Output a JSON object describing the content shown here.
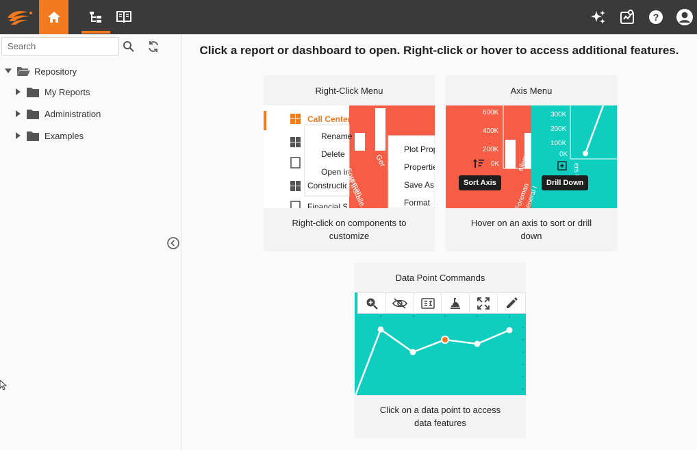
{
  "toolbar": {
    "logo_icon": "flame-logo-icon",
    "home_icon": "home-icon",
    "tree_icon": "tree-view-icon",
    "book_icon": "book-icon",
    "sparkle_icon": "sparkle-icon",
    "dashboard_icon": "dashboard-icon",
    "help_icon": "help-icon",
    "user_icon": "account-icon",
    "accent_color": "#f47a20"
  },
  "sidebar": {
    "search_placeholder": "Search",
    "tree": [
      {
        "label": "Repository",
        "expanded": true
      },
      {
        "label": "My Reports"
      },
      {
        "label": "Administration"
      },
      {
        "label": "Examples"
      }
    ]
  },
  "main": {
    "title": "Click a report or dashboard to open. Right-click or hover to access additional features.",
    "cards": [
      {
        "title": "Right-Click Menu",
        "description": "Right-click on components to customize",
        "items": [
          "Call Center",
          "Constructio",
          "Financial S"
        ],
        "context_menu": [
          "Rename",
          "Delete",
          "Open in"
        ],
        "sub_menu": [
          "Plot Prop",
          "Propertie",
          "Save As",
          "Format"
        ],
        "chart_labels": [
          "Foreman",
          "Ger",
          "al Installe..."
        ]
      },
      {
        "title": "Axis Menu",
        "description": "Hover on an axis to sort or drill down",
        "left_ticks": [
          "600K",
          "400K",
          "200K",
          "0K"
        ],
        "right_ticks": [
          "300K",
          "200K",
          "100K",
          "0K"
        ],
        "sort_tooltip": "Sort Axis",
        "drill_tooltip": "Drill Down",
        "axis_labels": [
          "allers",
          "Foreman",
          "General I"
        ],
        "right_axis_label": "ers Upd"
      },
      {
        "title": "Data Point Commands",
        "description": "Click on a data point to access data features",
        "tool_icons": [
          "zoom-in-icon",
          "hide-icon",
          "aggregate-icon",
          "explore-icon",
          "expand-icon",
          "edit-icon"
        ]
      }
    ]
  },
  "colors": {
    "coral": "#f75d45",
    "teal": "#10cebf",
    "topbar": "#3a3a3a"
  }
}
